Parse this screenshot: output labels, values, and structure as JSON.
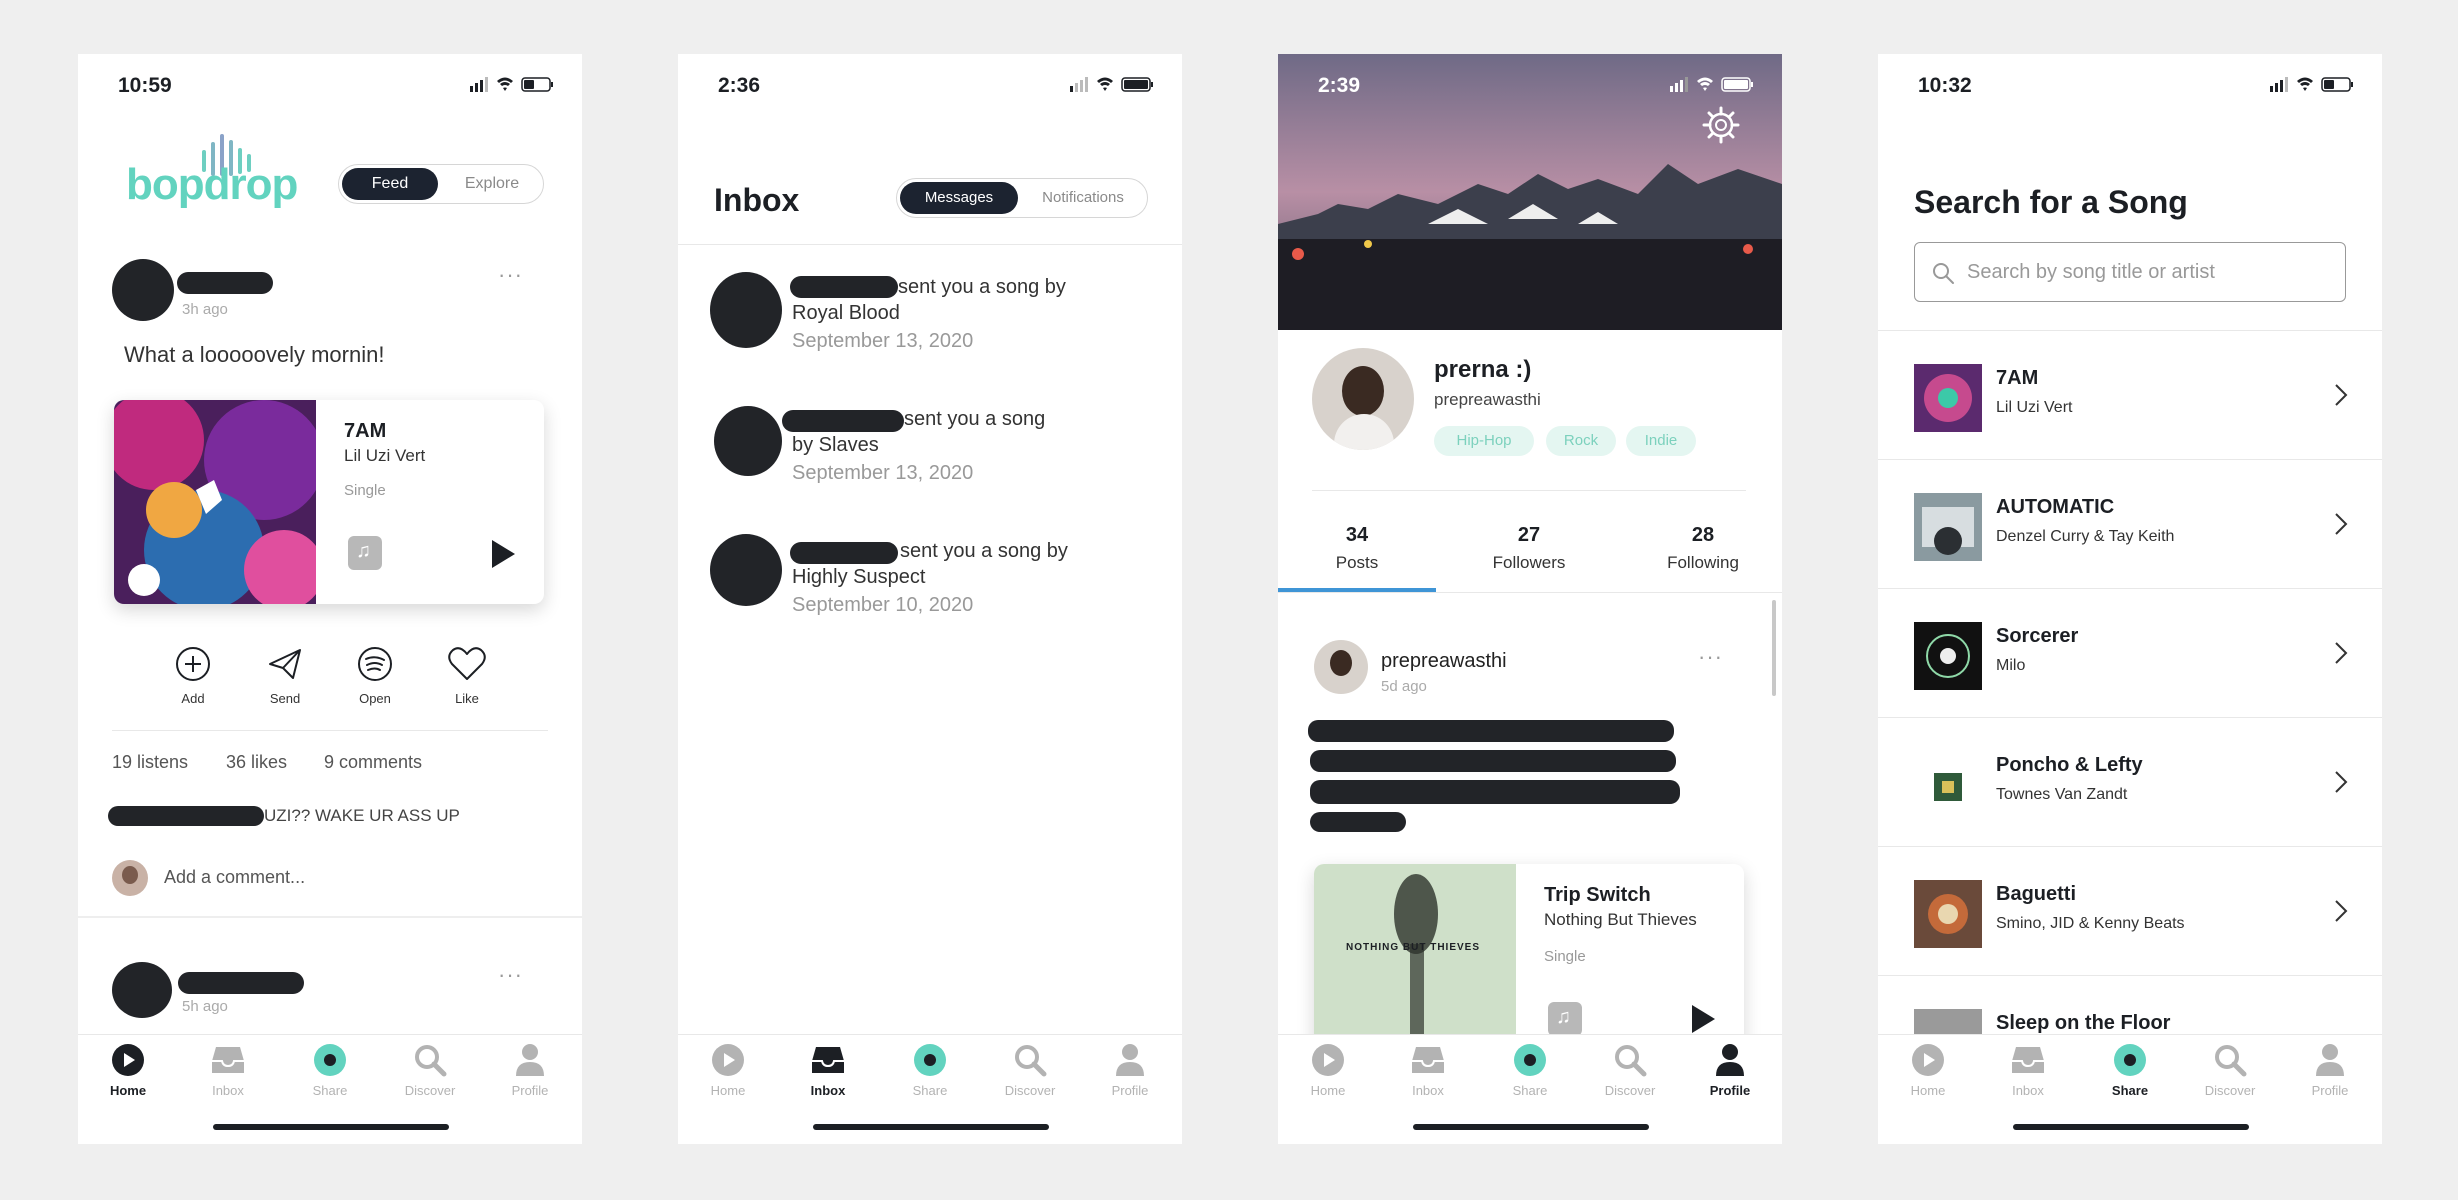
{
  "screens": {
    "feed": {
      "time": "10:59",
      "logo": "bopdrop",
      "toggle": {
        "active": "Feed",
        "inactive": "Explore"
      },
      "post": {
        "time_ago": "3h ago",
        "caption": "What a looooovely mornin!",
        "song": {
          "title": "7AM",
          "artist": "Lil Uzi Vert",
          "type": "Single"
        },
        "actions": [
          "Add",
          "Send",
          "Open",
          "Like"
        ],
        "stats": {
          "listens": "19 listens",
          "likes": "36 likes",
          "comments": "9 comments"
        },
        "comment_text": "UZI?? WAKE UR ASS UP",
        "comment_placeholder": "Add a comment..."
      },
      "next_post_time": "5h ago"
    },
    "inbox": {
      "time": "2:36",
      "title": "Inbox",
      "toggle": {
        "active": "Messages",
        "inactive": "Notifications"
      },
      "messages": [
        {
          "line1": "sent you a song by",
          "line2": "Royal Blood",
          "date": "September 13, 2020"
        },
        {
          "line1": "sent you a song",
          "line2": "by Slaves",
          "date": "September 13, 2020"
        },
        {
          "line1": "sent you a song by",
          "line2": "Highly Suspect",
          "date": "September 10, 2020"
        }
      ]
    },
    "profile": {
      "time": "2:39",
      "name": "prerna :)",
      "username": "prepreawasthi",
      "genres": [
        "Hip-Hop",
        "Rock",
        "Indie"
      ],
      "stats": [
        {
          "value": "34",
          "label": "Posts"
        },
        {
          "value": "27",
          "label": "Followers"
        },
        {
          "value": "28",
          "label": "Following"
        }
      ],
      "post": {
        "username": "prepreawasthi",
        "time_ago": "5d ago",
        "song": {
          "title": "Trip Switch",
          "artist": "Nothing But Thieves",
          "type": "Single",
          "album_text": "NOTHING BUT THIEVES"
        }
      }
    },
    "search": {
      "time": "10:32",
      "title": "Search for a Song",
      "placeholder": "Search by song title or artist",
      "results": [
        {
          "title": "7AM",
          "artist": "Lil Uzi Vert"
        },
        {
          "title": "AUTOMATIC",
          "artist": "Denzel Curry & Tay Keith"
        },
        {
          "title": "Sorcerer",
          "artist": "Milo"
        },
        {
          "title": "Poncho & Lefty",
          "artist": "Townes Van Zandt"
        },
        {
          "title": "Baguetti",
          "artist": "Smino, JID & Kenny Beats"
        },
        {
          "title": "Sleep on the Floor",
          "artist": ""
        }
      ]
    }
  },
  "tabbar": {
    "labels": [
      "Home",
      "Inbox",
      "Share",
      "Discover",
      "Profile"
    ]
  },
  "colors": {
    "accent": "#62d3bf",
    "dark": "#1c2330",
    "inactive": "#b3b3b3",
    "chip_bg": "#e4f6f1"
  },
  "icons": {
    "home": "play-circle-icon",
    "inbox": "inbox-tray-icon",
    "share": "share-disc-icon",
    "discover": "magnifier-icon",
    "profile": "person-icon"
  }
}
